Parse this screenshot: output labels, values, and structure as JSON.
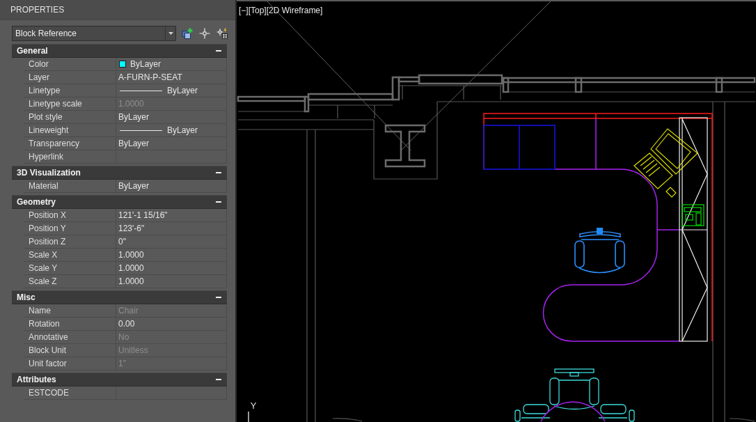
{
  "panel": {
    "title": "PROPERTIES",
    "object_type": "Block Reference"
  },
  "sections": [
    {
      "title": "General",
      "expanded": true,
      "properties": [
        {
          "name": "Color",
          "kind": "color",
          "color": "#00ffff",
          "value": "ByLayer",
          "disabled": false
        },
        {
          "name": "Layer",
          "kind": "text",
          "value": "A-FURN-P-SEAT",
          "disabled": false
        },
        {
          "name": "Linetype",
          "kind": "line",
          "value": "ByLayer",
          "disabled": false
        },
        {
          "name": "Linetype scale",
          "kind": "text",
          "value": "1.0000",
          "disabled": true
        },
        {
          "name": "Plot style",
          "kind": "text",
          "value": "ByLayer",
          "disabled": false
        },
        {
          "name": "Lineweight",
          "kind": "line",
          "value": "ByLayer",
          "disabled": false
        },
        {
          "name": "Transparency",
          "kind": "text",
          "value": "ByLayer",
          "disabled": false
        },
        {
          "name": "Hyperlink",
          "kind": "text",
          "disabled": false
        }
      ]
    },
    {
      "title": "3D Visualization",
      "expanded": true,
      "properties": [
        {
          "name": "Material",
          "kind": "text",
          "value": "ByLayer",
          "disabled": false
        }
      ]
    },
    {
      "title": "Geometry",
      "expanded": true,
      "properties": [
        {
          "name": "Position X",
          "kind": "text",
          "value": "121'-1 15/16\"",
          "disabled": false
        },
        {
          "name": "Position Y",
          "kind": "text",
          "value": "123'-6\"",
          "disabled": false
        },
        {
          "name": "Position Z",
          "kind": "text",
          "value": "0\"",
          "disabled": false
        },
        {
          "name": "Scale X",
          "kind": "text",
          "value": "1.0000",
          "disabled": false
        },
        {
          "name": "Scale Y",
          "kind": "text",
          "value": "1.0000",
          "disabled": false
        },
        {
          "name": "Scale Z",
          "kind": "text",
          "value": "1.0000",
          "disabled": false
        }
      ]
    },
    {
      "title": "Misc",
      "expanded": true,
      "properties": [
        {
          "name": "Name",
          "kind": "text",
          "value": "Chair",
          "disabled": true
        },
        {
          "name": "Rotation",
          "kind": "text",
          "value": "0.00",
          "disabled": false
        },
        {
          "name": "Annotative",
          "kind": "text",
          "value": "No",
          "disabled": true
        },
        {
          "name": "Block Unit",
          "kind": "text",
          "value": "Unitless",
          "disabled": true
        },
        {
          "name": "Unit factor",
          "kind": "text",
          "value": "1\"",
          "disabled": true
        }
      ]
    },
    {
      "title": "Attributes",
      "expanded": true,
      "properties": [
        {
          "name": "ESTCODE",
          "kind": "text",
          "disabled": false
        }
      ]
    }
  ],
  "viewport": {
    "controls": [
      "[−]",
      "[Top]",
      "[2D Wireframe]"
    ],
    "axis_label": "Y"
  }
}
